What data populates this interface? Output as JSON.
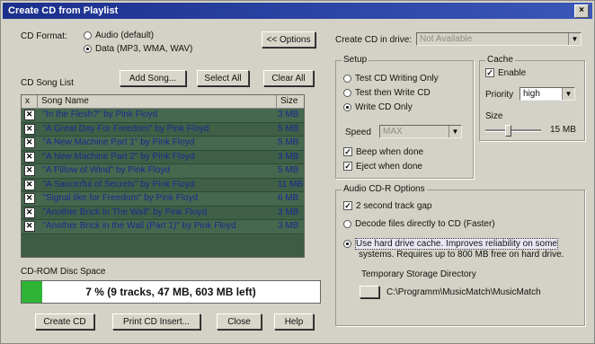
{
  "window": {
    "title": "Create CD from Playlist",
    "close_glyph": "×"
  },
  "cd_format": {
    "label": "CD Format:",
    "options": [
      "Audio (default)",
      "Data (MP3, WMA, WAV)"
    ],
    "selected": "Data (MP3, WMA, WAV)"
  },
  "options_button": "<< Options",
  "song_list": {
    "label": "CD Song List",
    "add_song": "Add Song...",
    "select_all": "Select All",
    "clear_all": "Clear All",
    "columns": [
      "x",
      "Song Name",
      "Size"
    ],
    "rows": [
      {
        "name": "\"In the Flesh?\" by Pink Floyd",
        "size": "3 MB"
      },
      {
        "name": "\"A Great Day For Freedom\" by Pink Floyd",
        "size": "5 MB"
      },
      {
        "name": "\"A New Machine Part 1\" by Pink Floyd",
        "size": "5 MB"
      },
      {
        "name": "\"A New Machine Part 2\" by Pink Floyd",
        "size": "3 MB"
      },
      {
        "name": "\"A Pillow of Wind\" by Pink Floyd",
        "size": "5 MB"
      },
      {
        "name": "\"A Saucerful of Secrets\" by Pink Floyd",
        "size": "11 MB"
      },
      {
        "name": "\"Signal like for Freedom\" by Pink Floyd",
        "size": "6 MB"
      },
      {
        "name": "\"Another Brick In The Wall\" by Pink Floyd",
        "size": "3 MB"
      },
      {
        "name": "\"Another Brick in the Wall (Part 1)\" by Pink Floyd",
        "size": "3 MB"
      }
    ]
  },
  "disc_space": {
    "label": "CD-ROM Disc Space",
    "percent": 7,
    "text": "7 % (9 tracks, 47 MB, 603 MB left)",
    "fill_color": "#2fb436"
  },
  "bottom_buttons": [
    "Create CD",
    "Print CD Insert...",
    "Close",
    "Help"
  ],
  "drive": {
    "label": "Create CD in drive:",
    "value": "Not Available"
  },
  "setup": {
    "title": "Setup",
    "options": [
      "Test CD Writing Only",
      "Test then Write CD",
      "Write CD Only"
    ],
    "selected": "Write CD Only",
    "speed_label": "Speed",
    "speed_value": "MAX",
    "beep": "Beep when done",
    "eject": "Eject when done"
  },
  "cache": {
    "title": "Cache",
    "enable": "Enable",
    "priority_label": "Priority",
    "priority_value": "high",
    "size_label": "Size",
    "size_value": "15 MB"
  },
  "audio_options": {
    "title": "Audio CD-R Options",
    "gap": "2 second track gap",
    "decode": "Decode files directly to CD (Faster)",
    "use_hd_line1": "Use hard drive cache. Improves reliability on some",
    "use_hd_line2": "systems. Requires up to 800 MB free on hard drive.",
    "temp_label": "Temporary Storage Directory",
    "temp_path": "C:\\Programm\\MusicMatch\\MusicMatch"
  }
}
